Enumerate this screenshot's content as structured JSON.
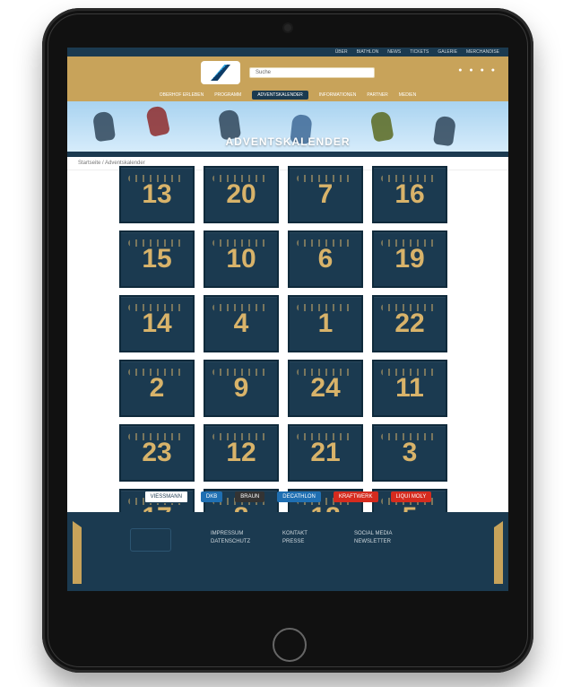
{
  "screen": {
    "topbar_items": [
      "ÜBER",
      "BIATHLON",
      "NEWS",
      "TICKETS",
      "GALERIE",
      "MERCHANDISE"
    ],
    "search": {
      "placeholder": "Suche"
    },
    "nav_items": [
      "OBERHOF ERLEBEN",
      "PROGRAMM",
      "ADVENTSKALENDER",
      "INFORMATIONEN",
      "PARTNER",
      "MEDIEN"
    ],
    "page_title": "ADVENTSKALENDER",
    "breadcrumb": "Startseite  /  Adventskalender",
    "advent_doors": [
      [
        "13",
        "20",
        "7",
        "16"
      ],
      [
        "15",
        "10",
        "6",
        "19"
      ],
      [
        "14",
        "4",
        "1",
        "22"
      ],
      [
        "2",
        "9",
        "24",
        "11"
      ],
      [
        "23",
        "12",
        "21",
        "3"
      ],
      [
        "17",
        "8",
        "18",
        "5"
      ]
    ],
    "sponsors": [
      "VIESSMANN",
      "DKB",
      "BRAUN",
      "DECATHLON",
      "KRAFTWERK",
      "LIQUI MOLY"
    ],
    "footer_columns": [
      [
        "IMPRESSUM",
        "DATENSCHUTZ"
      ],
      [
        "KONTAKT",
        "PRESSE"
      ],
      [
        "SOCIAL MEDIA",
        "NEWSLETTER"
      ]
    ]
  },
  "colors": {
    "navy": "#1b3a50",
    "gold": "#c8a35a"
  }
}
